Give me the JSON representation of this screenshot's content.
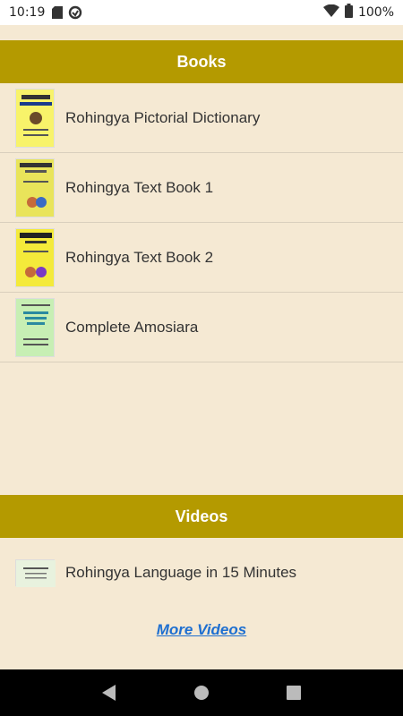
{
  "status_bar": {
    "time": "10:19",
    "battery": "100%"
  },
  "books": {
    "header": "Books",
    "items": [
      {
        "title": "Rohingya Pictorial Dictionary",
        "thumb_color": "#f8f36a"
      },
      {
        "title": "Rohingya Text Book 1",
        "thumb_color": "#e9e45a"
      },
      {
        "title": "Rohingya Text Book 2",
        "thumb_color": "#f4ea3a"
      },
      {
        "title": "Complete Amosiara",
        "thumb_color": "#c7efb4"
      }
    ]
  },
  "videos": {
    "header": "Videos",
    "items": [
      {
        "title": "Rohingya Language in 15 Minutes",
        "thumb_color": "#e8f2de"
      }
    ],
    "more_label": "More Videos"
  },
  "colors": {
    "header_bg": "#b49a00",
    "page_bg": "#f5e9d3",
    "link": "#1e6fd0"
  }
}
